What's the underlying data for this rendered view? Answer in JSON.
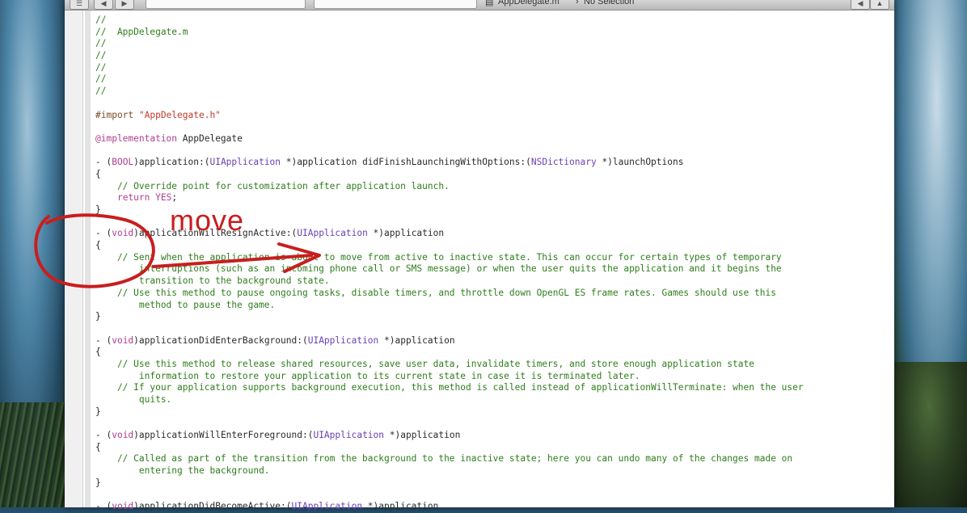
{
  "toolbar": {
    "file_name": "AppDelegate.m",
    "selection": "No Selection"
  },
  "code_lines": [
    {
      "spans": [
        {
          "t": "//",
          "c": "c-comment"
        }
      ]
    },
    {
      "spans": [
        {
          "t": "//  AppDelegate.m",
          "c": "c-comment"
        }
      ]
    },
    {
      "spans": [
        {
          "t": "//",
          "c": "c-comment"
        }
      ]
    },
    {
      "spans": [
        {
          "t": "//",
          "c": "c-comment"
        }
      ]
    },
    {
      "spans": [
        {
          "t": "//",
          "c": "c-comment"
        }
      ]
    },
    {
      "spans": [
        {
          "t": "//",
          "c": "c-comment"
        }
      ]
    },
    {
      "spans": [
        {
          "t": "//",
          "c": "c-comment"
        }
      ]
    },
    {
      "spans": [
        {
          "t": "",
          "c": ""
        }
      ]
    },
    {
      "spans": [
        {
          "t": "#import ",
          "c": "c-pre"
        },
        {
          "t": "\"AppDelegate.h\"",
          "c": "c-str"
        }
      ]
    },
    {
      "spans": [
        {
          "t": "",
          "c": ""
        }
      ]
    },
    {
      "spans": [
        {
          "t": "@implementation",
          "c": "c-kw"
        },
        {
          "t": " AppDelegate",
          "c": ""
        }
      ]
    },
    {
      "spans": [
        {
          "t": "",
          "c": ""
        }
      ]
    },
    {
      "spans": [
        {
          "t": "- (",
          "c": ""
        },
        {
          "t": "BOOL",
          "c": "c-kw"
        },
        {
          "t": ")application:(",
          "c": ""
        },
        {
          "t": "UIApplication",
          "c": "c-type"
        },
        {
          "t": " *)application didFinishLaunchingWithOptions:(",
          "c": ""
        },
        {
          "t": "NSDictionary",
          "c": "c-type"
        },
        {
          "t": " *)launchOptions",
          "c": ""
        }
      ]
    },
    {
      "spans": [
        {
          "t": "{",
          "c": ""
        }
      ]
    },
    {
      "spans": [
        {
          "t": "    // Override point for customization after application launch.",
          "c": "c-comment"
        }
      ]
    },
    {
      "spans": [
        {
          "t": "    ",
          "c": ""
        },
        {
          "t": "return",
          "c": "c-kw"
        },
        {
          "t": " ",
          "c": ""
        },
        {
          "t": "YES",
          "c": "c-kw"
        },
        {
          "t": ";",
          "c": ""
        }
      ]
    },
    {
      "spans": [
        {
          "t": "}",
          "c": ""
        }
      ]
    },
    {
      "spans": [
        {
          "t": "",
          "c": ""
        }
      ]
    },
    {
      "spans": [
        {
          "t": "- (",
          "c": ""
        },
        {
          "t": "void",
          "c": "c-kw"
        },
        {
          "t": ")applicationWillResignActive:(",
          "c": ""
        },
        {
          "t": "UIApplication",
          "c": "c-type"
        },
        {
          "t": " *)application",
          "c": ""
        }
      ]
    },
    {
      "spans": [
        {
          "t": "{",
          "c": ""
        }
      ]
    },
    {
      "spans": [
        {
          "t": "    // Sent when the application is about to move from active to inactive state. This can occur for certain types of temporary",
          "c": "c-comment"
        }
      ]
    },
    {
      "spans": [
        {
          "t": "        interruptions (such as an incoming phone call or SMS message) or when the user quits the application and it begins the",
          "c": "c-comment"
        }
      ]
    },
    {
      "spans": [
        {
          "t": "        transition to the background state.",
          "c": "c-comment"
        }
      ]
    },
    {
      "spans": [
        {
          "t": "    // Use this method to pause ongoing tasks, disable timers, and throttle down OpenGL ES frame rates. Games should use this",
          "c": "c-comment"
        }
      ]
    },
    {
      "spans": [
        {
          "t": "        method to pause the game.",
          "c": "c-comment"
        }
      ]
    },
    {
      "spans": [
        {
          "t": "}",
          "c": ""
        }
      ]
    },
    {
      "spans": [
        {
          "t": "",
          "c": ""
        }
      ]
    },
    {
      "spans": [
        {
          "t": "- (",
          "c": ""
        },
        {
          "t": "void",
          "c": "c-kw"
        },
        {
          "t": ")applicationDidEnterBackground:(",
          "c": ""
        },
        {
          "t": "UIApplication",
          "c": "c-type"
        },
        {
          "t": " *)application",
          "c": ""
        }
      ]
    },
    {
      "spans": [
        {
          "t": "{",
          "c": ""
        }
      ]
    },
    {
      "spans": [
        {
          "t": "    // Use this method to release shared resources, save user data, invalidate timers, and store enough application state",
          "c": "c-comment"
        }
      ]
    },
    {
      "spans": [
        {
          "t": "        information to restore your application to its current state in case it is terminated later.",
          "c": "c-comment"
        }
      ]
    },
    {
      "spans": [
        {
          "t": "    // If your application supports background execution, this method is called instead of applicationWillTerminate: when the user",
          "c": "c-comment"
        }
      ]
    },
    {
      "spans": [
        {
          "t": "        quits.",
          "c": "c-comment"
        }
      ]
    },
    {
      "spans": [
        {
          "t": "}",
          "c": ""
        }
      ]
    },
    {
      "spans": [
        {
          "t": "",
          "c": ""
        }
      ]
    },
    {
      "spans": [
        {
          "t": "- (",
          "c": ""
        },
        {
          "t": "void",
          "c": "c-kw"
        },
        {
          "t": ")applicationWillEnterForeground:(",
          "c": ""
        },
        {
          "t": "UIApplication",
          "c": "c-type"
        },
        {
          "t": " *)application",
          "c": ""
        }
      ]
    },
    {
      "spans": [
        {
          "t": "{",
          "c": ""
        }
      ]
    },
    {
      "spans": [
        {
          "t": "    // Called as part of the transition from the background to the inactive state; here you can undo many of the changes made on",
          "c": "c-comment"
        }
      ]
    },
    {
      "spans": [
        {
          "t": "        entering the background.",
          "c": "c-comment"
        }
      ]
    },
    {
      "spans": [
        {
          "t": "}",
          "c": ""
        }
      ]
    },
    {
      "spans": [
        {
          "t": "",
          "c": ""
        }
      ]
    },
    {
      "spans": [
        {
          "t": "- (",
          "c": ""
        },
        {
          "t": "void",
          "c": "c-kw"
        },
        {
          "t": ")applicationDidBecomeActive:(",
          "c": ""
        },
        {
          "t": "UIApplication",
          "c": "c-type"
        },
        {
          "t": " *)application",
          "c": ""
        }
      ]
    }
  ],
  "annotation": {
    "label": "move",
    "color": "#c81e1e"
  },
  "colors": {
    "comment": "#2f7d1d",
    "keyword": "#b03d8f",
    "string": "#c23a2a",
    "type": "#6a3fb3"
  }
}
